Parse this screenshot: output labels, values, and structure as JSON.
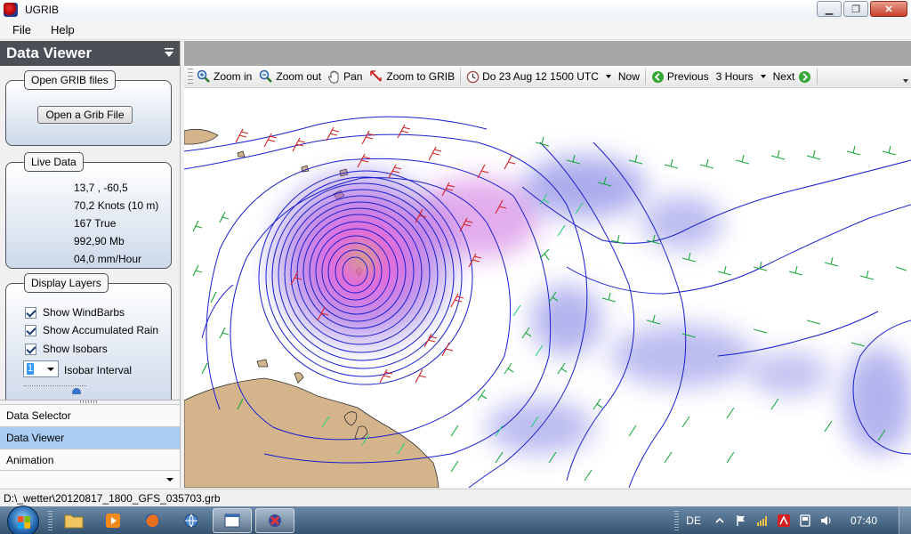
{
  "window": {
    "title": "UGRIB"
  },
  "menu": {
    "file": "File",
    "help": "Help"
  },
  "left_panel": {
    "title": "Data Viewer",
    "open_files": {
      "group_title": "Open GRIB files",
      "button": "Open a Grib File"
    },
    "live_data": {
      "group_title": "Live Data",
      "position": "13,7 ,  -60,5",
      "wind": "70,2 Knots (10 m)",
      "direction": "167 True",
      "pressure": "992,90 Mb",
      "rain": "04,0 mm/Hour"
    },
    "display_layers": {
      "group_title": "Display Layers",
      "windbarbs": "Show WindBarbs",
      "rain": "Show Accumulated Rain",
      "isobars": "Show Isobars",
      "isobar_interval_value": "1",
      "isobar_interval_label": "Isobar Interval"
    },
    "nav": {
      "data_selector": "Data Selector",
      "data_viewer": "Data Viewer",
      "animation": "Animation"
    }
  },
  "toolbar": {
    "zoom_in": "Zoom in",
    "zoom_out": "Zoom out",
    "pan": "Pan",
    "zoom_to_grib": "Zoom to GRIB",
    "datetime": "Do 23 Aug 12 1500 UTC",
    "now": "Now",
    "previous": "Previous",
    "step": "3 Hours",
    "next": "Next"
  },
  "status": {
    "file_path": "D:\\_wetter\\20120817_1800_GFS_035703.grb"
  },
  "taskbar": {
    "language": "DE",
    "clock": "07:40"
  },
  "colors": {
    "panel_header": "#4b5057",
    "nav_active": "#a9cdf2",
    "isobar": "#1a1fcf",
    "barb_strong": "#d42020",
    "barb_medium": "#18a838",
    "barb_light": "#2ad07a",
    "rain_core": "#e24bd6",
    "rain_outer": "#6a6adf",
    "land": "#d4b48a"
  }
}
